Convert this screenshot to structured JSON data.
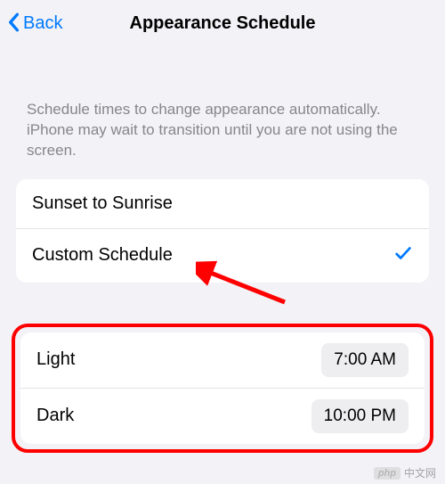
{
  "nav": {
    "back_label": "Back",
    "title": "Appearance Schedule"
  },
  "description": "Schedule times to change appearance automatically. iPhone may wait to transition until you are not using the screen.",
  "schedule_options": {
    "sunset": {
      "label": "Sunset to Sunrise",
      "selected": false
    },
    "custom": {
      "label": "Custom Schedule",
      "selected": true
    }
  },
  "times": {
    "light": {
      "label": "Light",
      "value": "7:00 AM"
    },
    "dark": {
      "label": "Dark",
      "value": "10:00 PM"
    }
  },
  "watermark": {
    "badge": "php",
    "text": "中文网"
  }
}
